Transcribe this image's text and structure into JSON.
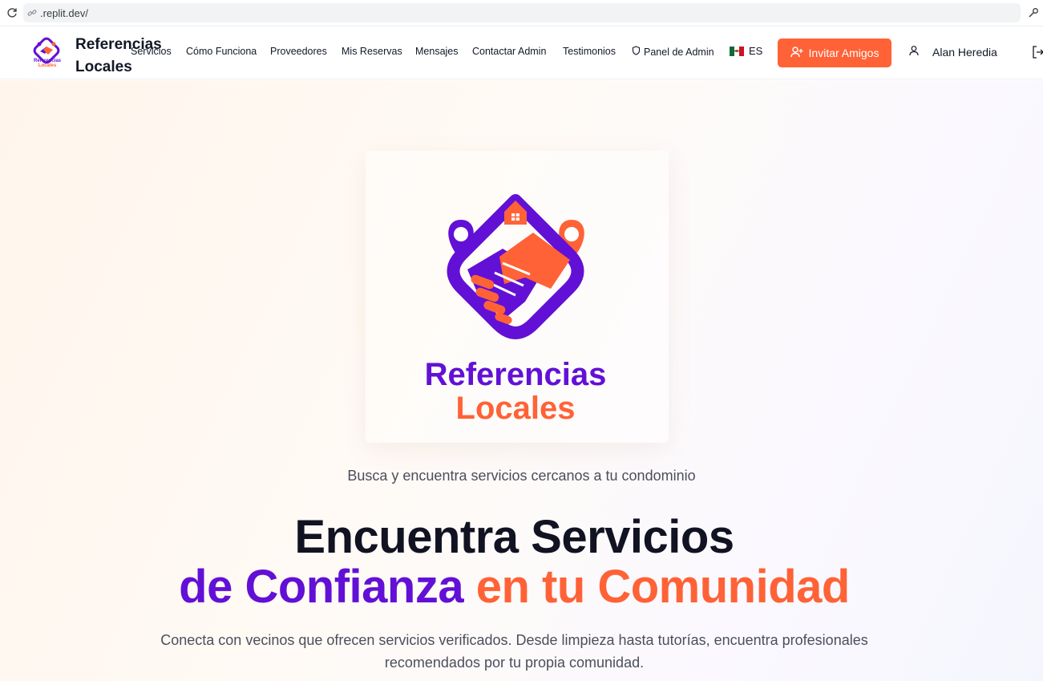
{
  "browser": {
    "url": ".replit.dev/",
    "reload_icon": "reload-icon",
    "link_icon": "link-icon",
    "tools_icon": "wrench-icon"
  },
  "navbar": {
    "brand": {
      "name": "Referencias Locales",
      "logo_text_top": "Referencias",
      "logo_text_bottom": "Locales"
    },
    "items": [
      {
        "label": "Servicios"
      },
      {
        "label": "Cómo Funciona"
      },
      {
        "label": "Proveedores"
      },
      {
        "label": "Mis Reservas"
      },
      {
        "label": "Mensajes"
      },
      {
        "label": "Contactar Admin"
      },
      {
        "label": "Testimonios"
      },
      {
        "label": "Panel de Admin",
        "icon": "shield-icon"
      }
    ],
    "language": {
      "label": "ES",
      "flag": "mexico-flag"
    },
    "invite_button": {
      "label": "Invitar Amigos",
      "icon": "user-plus-icon"
    },
    "user": {
      "name": "Alan Heredia",
      "icon": "user-icon"
    },
    "logout_icon": "logout-icon"
  },
  "hero": {
    "logo": {
      "text_top": "Referencias",
      "text_bottom": "Locales"
    },
    "tagline": "Busca y encuentra servicios cercanos a tu condominio",
    "title_line1": "Encuentra Servicios",
    "title_line2_purple": "de Confianza",
    "title_line2_orange": "en tu Comunidad",
    "description": "Conecta con vecinos que ofrecen servicios verificados. Desde limpieza hasta tutorías, encuentra profesionales recomendados por tu propia comunidad."
  },
  "colors": {
    "brand_purple": "#6210d6",
    "brand_orange": "#ff6236",
    "text_dark": "#111322",
    "text_muted": "#4b4f5c"
  }
}
